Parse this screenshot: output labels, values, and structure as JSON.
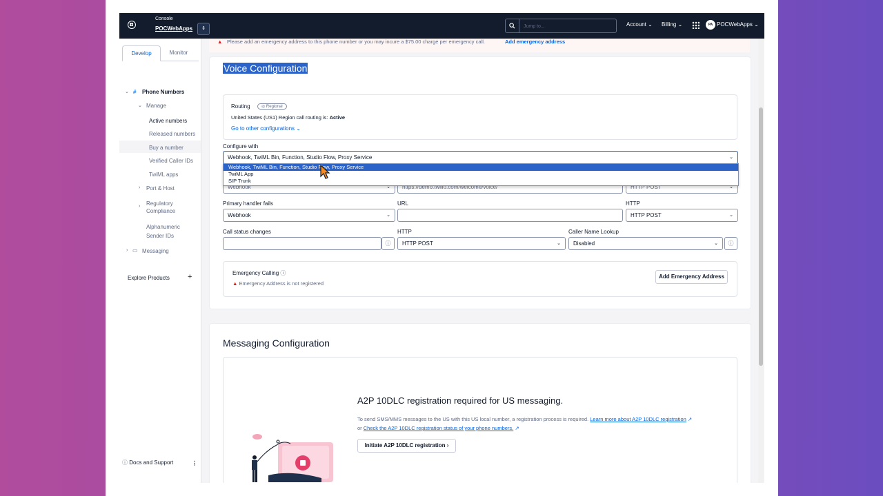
{
  "topbar": {
    "console_label": "Console",
    "account_name": "POCWebApps",
    "search_placeholder": "Jump to...",
    "account_menu": "Account",
    "billing_menu": "Billing",
    "avatar_initials": "PA",
    "user_name": "POCWebApps"
  },
  "sidebar": {
    "tab_develop": "Develop",
    "tab_monitor": "Monitor",
    "phone_numbers": "Phone Numbers",
    "manage": "Manage",
    "active_numbers": "Active numbers",
    "released_numbers": "Released numbers",
    "buy_number": "Buy a number",
    "verified_caller_ids": "Verified Caller IDs",
    "twiml_apps": "TwiML apps",
    "port_host": "Port & Host",
    "regulatory_1": "Regulatory",
    "regulatory_2": "Compliance",
    "alnum_1": "Alphanumeric",
    "alnum_2": "Sender IDs",
    "messaging": "Messaging",
    "explore_products": "Explore Products",
    "docs_support": "Docs and Support"
  },
  "banner": {
    "text": "Please add an emergency address to this phone number or you may incure a $75.00 charge per emergency call.",
    "link": "Add emergency address"
  },
  "voice": {
    "title": "Voice Configuration",
    "routing_label": "Routing",
    "routing_pill": "Regional",
    "routing_text": "United States (US1) Region call routing is:",
    "routing_status": "Active",
    "other_configs": "Go to other configurations",
    "configure_with_label": "Configure with",
    "configure_with_value": "Webhook, TwiML Bin, Function, Studio Flow, Proxy Service",
    "dropdown_options": [
      "Webhook, TwiML Bin, Function, Studio Flow, Proxy Service",
      "TwiML App",
      "SIP Trunk"
    ],
    "incoming_handler": "Webhook",
    "incoming_url": "https://demo.twilio.com/welcome/voice/",
    "incoming_method": "HTTP POST",
    "primary_fails_label": "Primary handler fails",
    "primary_fails_value": "Webhook",
    "url_label": "URL",
    "http_label": "HTTP",
    "primary_method": "HTTP POST",
    "call_status_label": "Call status changes",
    "call_status_http_label": "HTTP",
    "call_status_method": "HTTP POST",
    "caller_name_label": "Caller Name Lookup",
    "caller_name_value": "Disabled",
    "emergency_label": "Emergency Calling",
    "emergency_status": "Emergency Address is not registered",
    "add_emergency_button": "Add Emergency Address"
  },
  "messaging": {
    "title": "Messaging Configuration",
    "a2p_title": "A2P 10DLC registration required for US messaging.",
    "a2p_text": "To send SMS/MMS messages to the US with this US local number, a registration process is required.",
    "a2p_link1": "Learn more about A2P 10DLC registration",
    "a2p_or": "or",
    "a2p_link2": "Check the A2P 10DLC registration status of your phone numbers.",
    "a2p_button": "Initiate A2P 10DLC registration"
  }
}
